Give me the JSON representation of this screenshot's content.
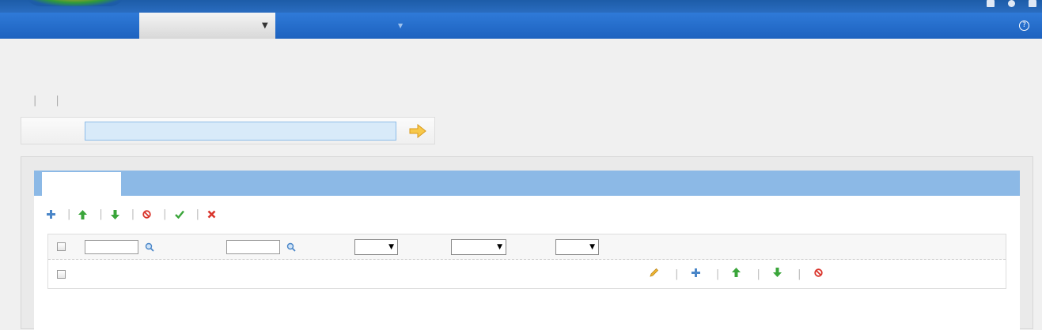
{
  "header": {
    "language_label": "",
    "user_label": "",
    "logout_label": ""
  },
  "nav": {
    "items": [
      {
        "label": ""
      },
      {
        "label": ""
      },
      {
        "label": ""
      }
    ],
    "help_label": ""
  },
  "page": {
    "title": "",
    "breadcrumb": {
      "home": "",
      "separator": "",
      "section": "",
      "current": ""
    }
  },
  "search": {
    "tabs": [
      {
        "label": ""
      },
      {
        "label": ""
      },
      {
        "label": ""
      }
    ],
    "label": "",
    "placeholder": ""
  },
  "main_tabs": [
    {
      "label": ""
    },
    {
      "label": ""
    },
    {
      "label": ""
    },
    {
      "label": ""
    },
    {
      "label": ""
    },
    {
      "label": ""
    },
    {
      "label": ""
    },
    {
      "label": ""
    }
  ],
  "actions": [
    {
      "label": "",
      "icon": "plus-icon"
    },
    {
      "label": "",
      "icon": "arrow-up-icon"
    },
    {
      "label": "",
      "icon": "arrow-down-icon"
    },
    {
      "label": "",
      "icon": "forbid-icon"
    },
    {
      "label": "",
      "icon": "check-icon"
    },
    {
      "label": "",
      "icon": "cross-icon"
    }
  ],
  "table": {
    "headers": {
      "ip": "",
      "weight": "",
      "type": "",
      "type_value": "",
      "status": "",
      "status_value": "",
      "check": "",
      "check_value": "",
      "operations": ""
    },
    "rows": [
      {
        "ip": "",
        "weight": "",
        "type": "",
        "status": "",
        "check": "",
        "ops": {
          "edit": "",
          "copy": "",
          "double": "",
          "halve": "",
          "disable": ""
        }
      }
    ]
  },
  "footer": {
    "total": ""
  },
  "colors": {
    "nav_blue": "#1d62bf",
    "tab_blue": "#8cb9e6",
    "link_blue": "#2a6cc0",
    "ok_green": "#2e9a2e",
    "danger_red": "#d9342b"
  }
}
